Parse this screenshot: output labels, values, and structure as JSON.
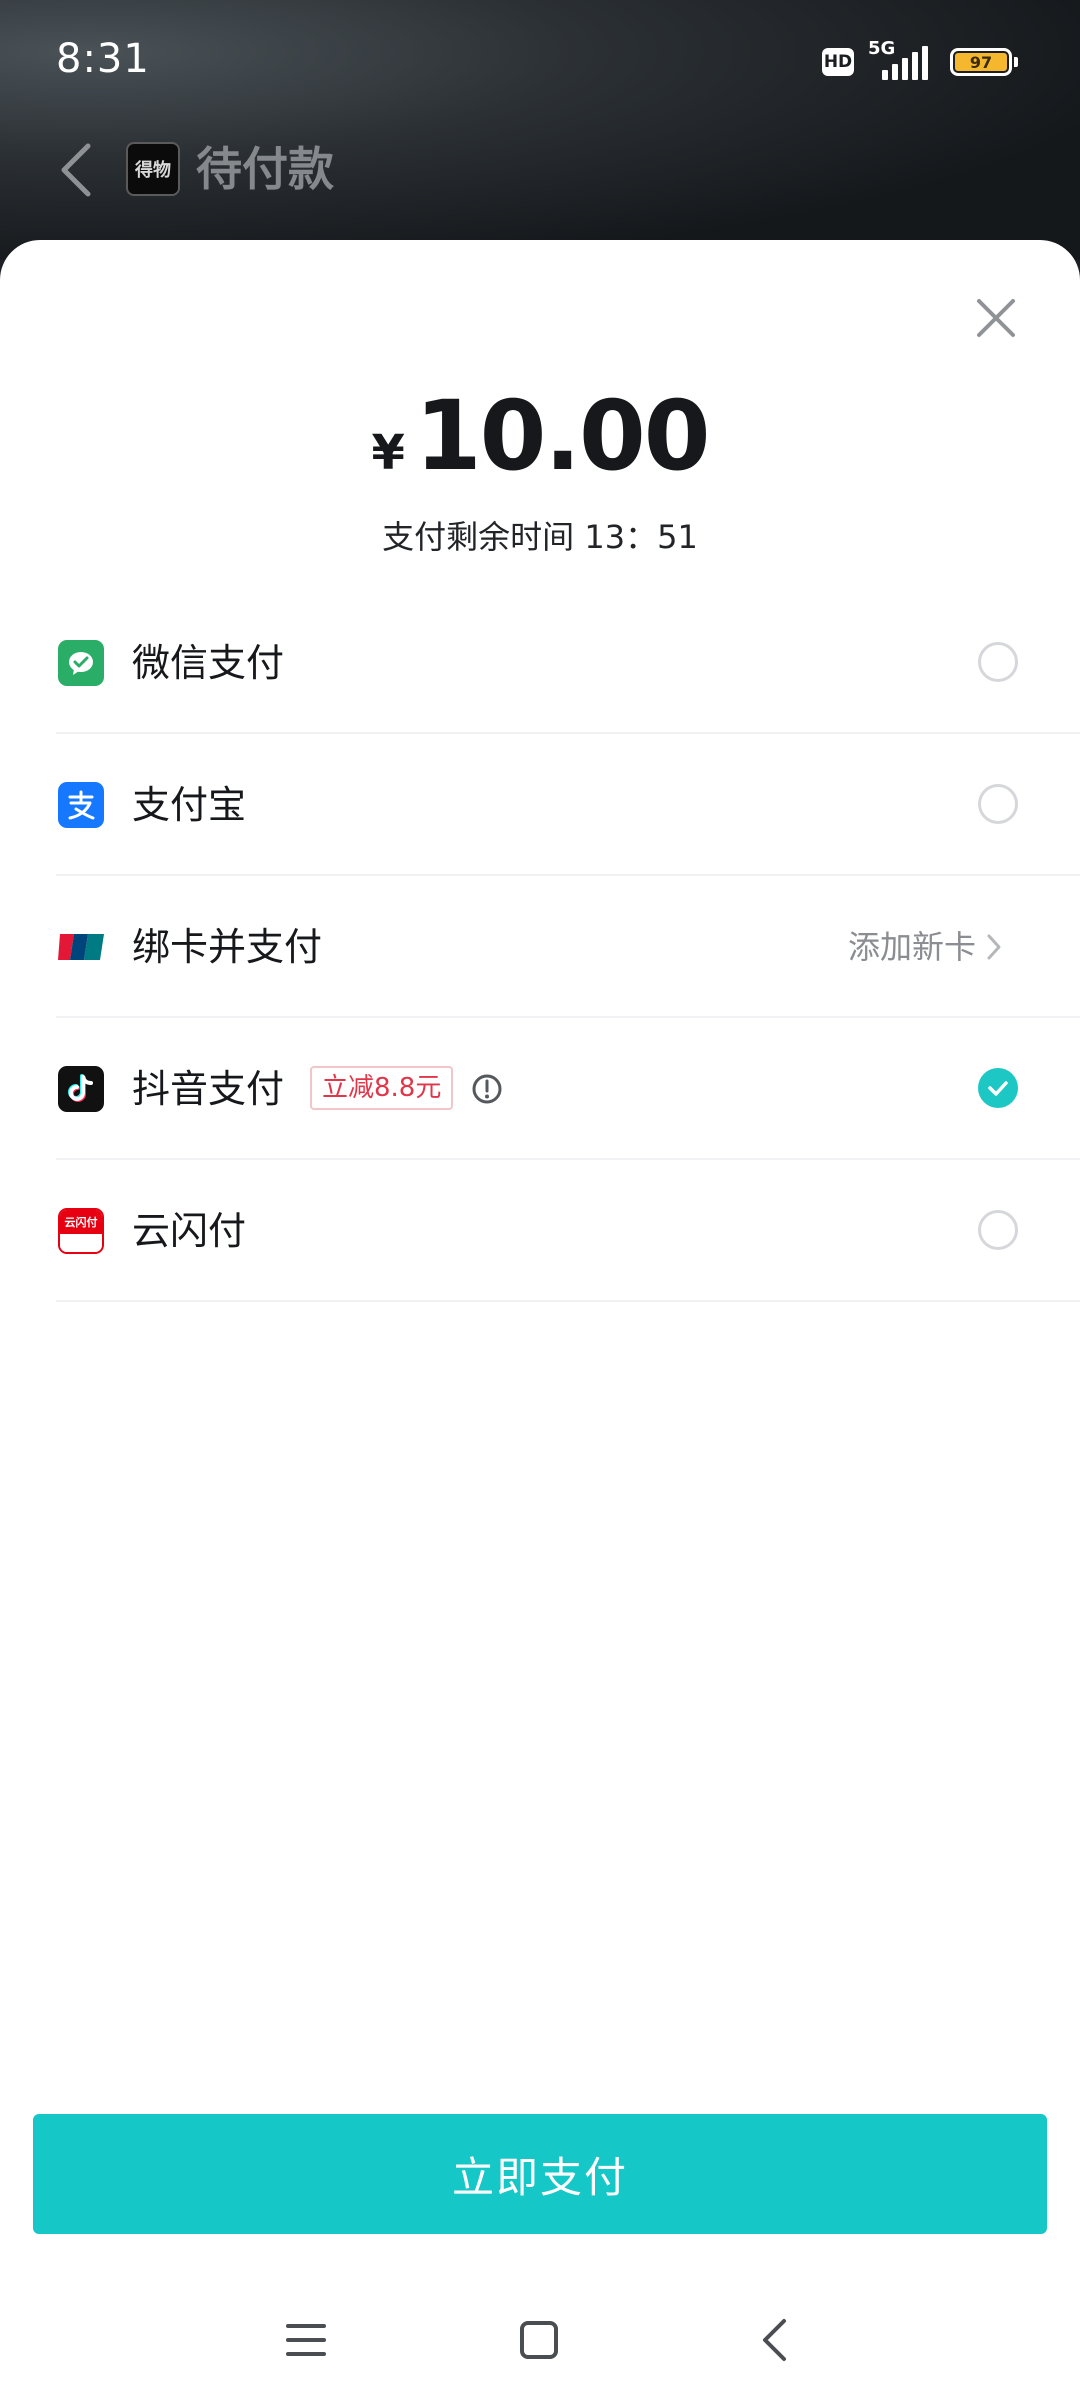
{
  "status_bar": {
    "time": "8:31",
    "hd": "HD",
    "network": "5G",
    "battery": "97"
  },
  "header": {
    "logo_text": "得物",
    "title": "待付款"
  },
  "payment": {
    "currency_symbol": "¥",
    "amount": "10.00",
    "countdown_label": "支付剩余时间",
    "countdown_value": "13：51"
  },
  "methods": [
    {
      "label": "微信支付",
      "icon": "wechat-pay-icon",
      "selected": false
    },
    {
      "label": "支付宝",
      "icon": "alipay-icon",
      "selected": false
    },
    {
      "label": "绑卡并支付",
      "icon": "unionpay-icon",
      "action": "添加新卡"
    },
    {
      "label": "抖音支付",
      "icon": "douyin-icon",
      "selected": true,
      "promo": "立减8.8元"
    },
    {
      "label": "云闪付",
      "icon": "quickpass-icon",
      "icon_text": "云闪付",
      "selected": false
    }
  ],
  "submit_label": "立即支付",
  "colors": {
    "accent": "#16c7c7",
    "promo": "#e0364a",
    "wechat": "#2aae67",
    "alipay": "#1677ff",
    "quickpass": "#e60012"
  }
}
